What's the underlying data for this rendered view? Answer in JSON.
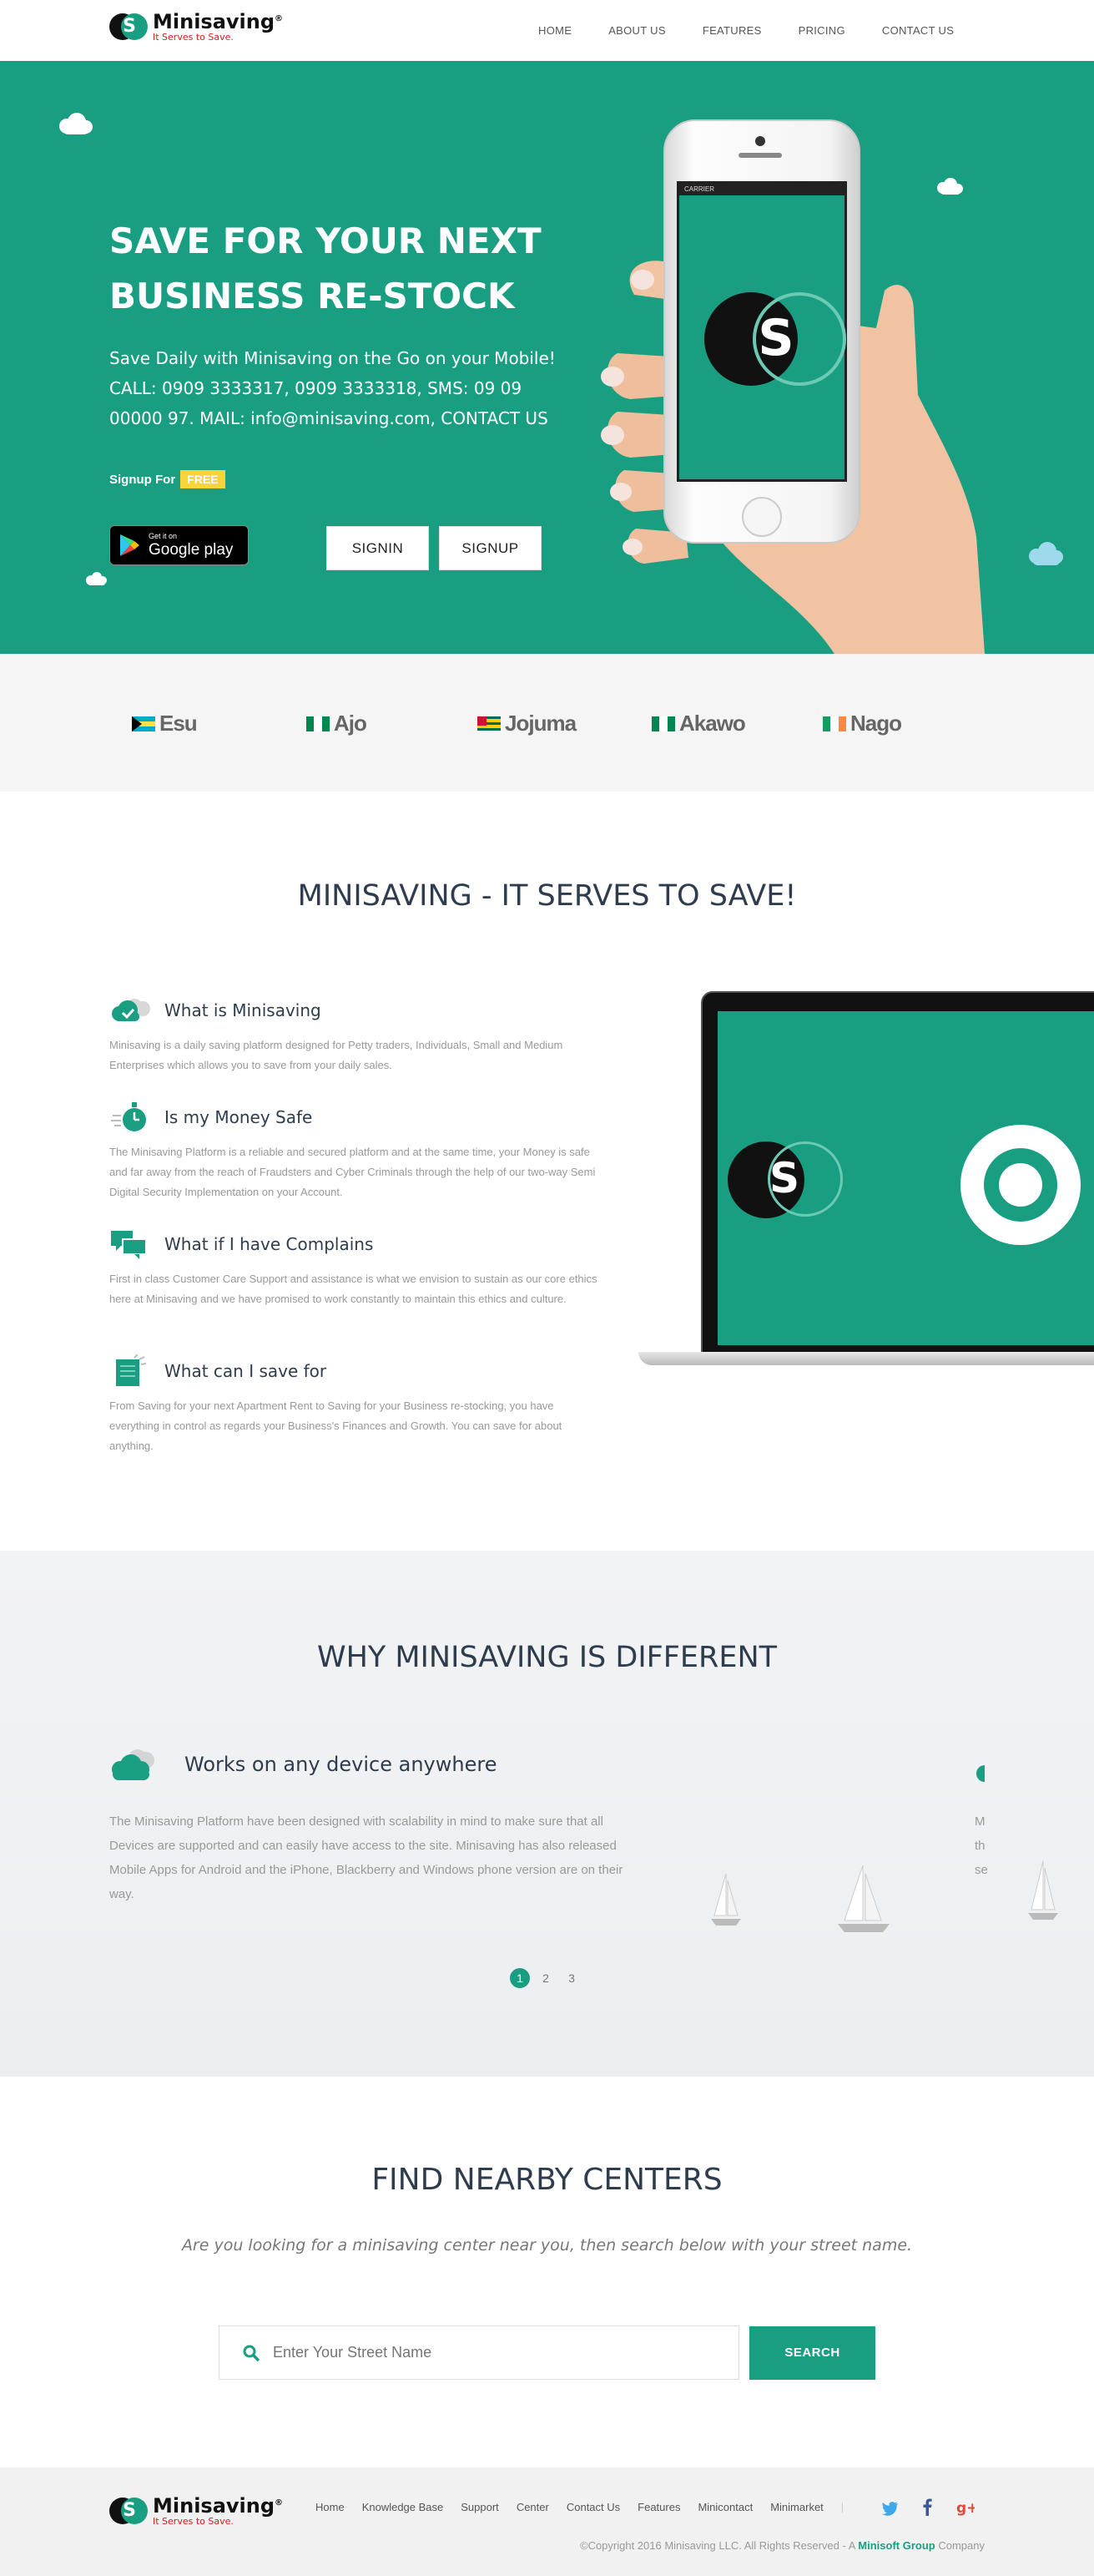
{
  "header": {
    "logo_letter": "S",
    "logo_name": "Minisaving",
    "logo_reg": "®",
    "logo_tagline": "It Serves to Save.",
    "nav": [
      "HOME",
      "ABOUT US",
      "FEATURES",
      "PRICING",
      "CONTACT US"
    ]
  },
  "hero": {
    "title_line1": "SAVE FOR YOUR NEXT",
    "title_line2": "BUSINESS RE-STOCK",
    "subtitle": "Save Daily with Minisaving on the Go on your Mobile! CALL: 0909 3333317, 0909 3333318, SMS: 09 09 00000 97. MAIL: info@minisaving.com, CONTACT US",
    "signup_for": "Signup For",
    "free_badge": "FREE",
    "gplay_small": "Get it on",
    "gplay_big": "Google play",
    "signin_button": "SIGNIN",
    "signup_button": "SIGNUP",
    "phone_carrier": "CARRIER",
    "phone_logo_letter": "S"
  },
  "brands": [
    {
      "name": "Esu",
      "flag": "bahamas"
    },
    {
      "name": "Ajo",
      "flag": "nigeria"
    },
    {
      "name": "Jojuma",
      "flag": "togo"
    },
    {
      "name": "Akawo",
      "flag": "nigeria"
    },
    {
      "name": "Nago",
      "flag": "ireland"
    }
  ],
  "about": {
    "title": "MINISAVING - IT SERVES TO SAVE!",
    "features": [
      {
        "icon": "cloud-check-icon",
        "title": "What is Minisaving",
        "body": "Minisaving is a daily saving platform designed for Petty traders, Individuals, Small and Medium Enterprises which allows you to save from your daily sales."
      },
      {
        "icon": "stopwatch-icon",
        "title": "Is my Money Safe",
        "body": "The Minisaving Platform is a reliable and secured platform and at the same time, your Money is safe and far away from the reach of Fraudsters and Cyber Criminals through the help of our two-way Semi Digital Security Implementation on your Account."
      },
      {
        "icon": "chat-bubbles-icon",
        "title": "What if I have Complains",
        "body": "First in class Customer Care Support and assistance is what we envision to sustain as our core ethics here at Minisaving and we have promised to work constantly to maintain this ethics and culture."
      },
      {
        "icon": "document-icon",
        "title": "What can I save for",
        "body": "From Saving for your next Apartment Rent to Saving for your Business re-stocking, you have everything in control as regards your Business's Finances and Growth. You can save for about anything."
      }
    ],
    "laptop_logo_letter": "S"
  },
  "why": {
    "title": "WHY MINISAVING IS DIFFERENT",
    "card_title": "Works on any device anywhere",
    "card_body": "The Minisaving Platform have been designed with scalability in mind to make sure that all Devices are supported and can easily have access to the site. Minisaving has also released Mobile Apps for Android and the iPhone, Blackberry and Windows phone version are on their way.",
    "peek_lines": [
      "M",
      "th",
      "se"
    ],
    "pages": [
      "1",
      "2",
      "3"
    ],
    "active_page": 1
  },
  "find": {
    "title": "FIND NEARBY CENTERS",
    "subtitle": "Are you looking for a minisaving center near you, then search below with your street name.",
    "placeholder": "Enter Your Street Name",
    "button": "SEARCH"
  },
  "footer": {
    "logo_letter": "S",
    "logo_name": "Minisaving",
    "logo_reg": "®",
    "logo_tagline": "It Serves to Save.",
    "links": [
      "Home",
      "Knowledge Base",
      "Support",
      "Center",
      "Contact Us",
      "Features",
      "Minicontact",
      "Minimarket"
    ],
    "copyright_prefix": "©Copyright 2016 Minisaving LLC. All Rights Reserved - A",
    "copyright_company": "Minisoft Group",
    "copyright_suffix": "Company"
  },
  "colors": {
    "brand_green": "#1a9e82",
    "free_yellow": "#f7d33c",
    "tagline_red": "#d21c1c",
    "heading": "#2e3c4d"
  }
}
